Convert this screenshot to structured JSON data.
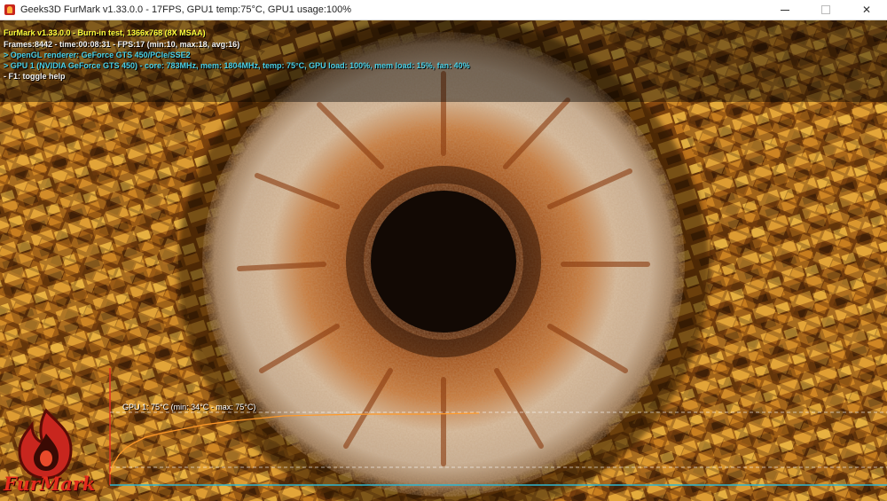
{
  "window": {
    "title": "Geeks3D FurMark v1.33.0.0 - 17FPS, GPU1 temp:75°C, GPU1 usage:100%",
    "minimize_icon": "minimize-icon",
    "maximize_icon": "maximize-icon",
    "close_glyph": "✕"
  },
  "hud": {
    "line1": "FurMark v1.33.0.0 - Burn-in test, 1366x768 (8X MSAA)",
    "line2": "Frames:8442 - time:00:08:31 - FPS:17 (min:10, max:18, avg:16)",
    "line3": "> OpenGL renderer: GeForce GTS 450/PCIe/SSE2",
    "line4": "> GPU 1 (NVIDIA GeForce GTS 450) - core: 783MHz, mem: 1804MHz, temp: 75°C, GPU load: 100%, mem load: 15%, fan: 40%",
    "line5": "- F1: toggle help",
    "colors": {
      "yellow": "#ffff3c",
      "white": "#f2f2f2",
      "cyan": "#4ad0e6"
    }
  },
  "temp_graph": {
    "label": "GPU 1: 75°C (min: 34°C - max: 75°C)",
    "current": 75,
    "min": 34,
    "max": 75,
    "line_color": "#ff9a2a",
    "axis_color": "#2fb6cf"
  },
  "logo": {
    "text": "FurMark",
    "icon": "furmark-flame-logo",
    "color": "#e42b1c"
  },
  "scene": {
    "subject": "fur-eye-render",
    "colors": {
      "fur": "#d8c6b2",
      "iris": "#a24e18",
      "pupil": "#140a05",
      "tunnel": "#c9821f"
    }
  }
}
